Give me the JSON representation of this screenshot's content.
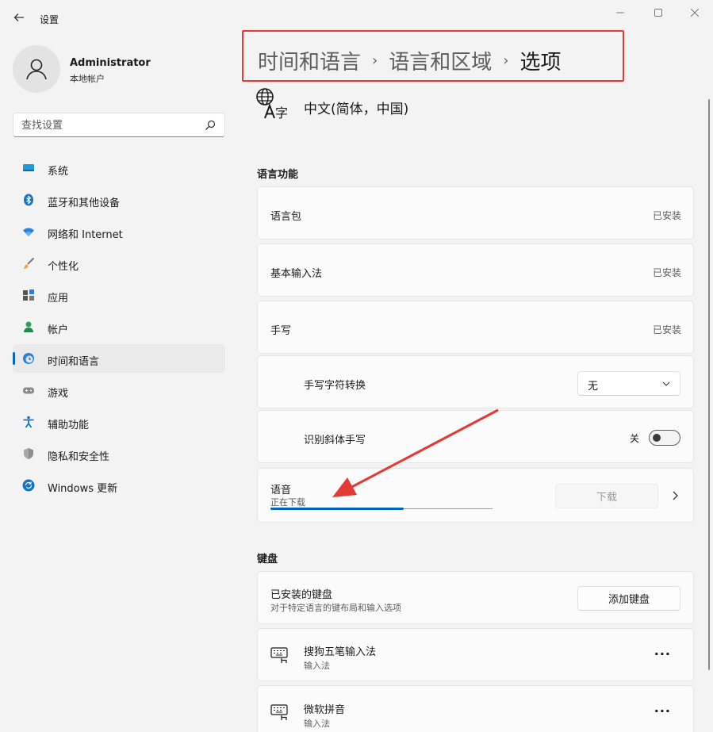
{
  "window": {
    "title": "设置"
  },
  "profile": {
    "name": "Administrator",
    "account_type": "本地帐户"
  },
  "search": {
    "placeholder": "查找设置"
  },
  "sidebar": {
    "items": [
      {
        "label": "系统",
        "icon": "system-icon",
        "active": false
      },
      {
        "label": "蓝牙和其他设备",
        "icon": "bluetooth-icon",
        "active": false
      },
      {
        "label": "网络和 Internet",
        "icon": "wifi-icon",
        "active": false
      },
      {
        "label": "个性化",
        "icon": "brush-icon",
        "active": false
      },
      {
        "label": "应用",
        "icon": "apps-icon",
        "active": false
      },
      {
        "label": "帐户",
        "icon": "account-icon",
        "active": false
      },
      {
        "label": "时间和语言",
        "icon": "time-language-icon",
        "active": true
      },
      {
        "label": "游戏",
        "icon": "gamepad-icon",
        "active": false
      },
      {
        "label": "辅助功能",
        "icon": "accessibility-icon",
        "active": false
      },
      {
        "label": "隐私和安全性",
        "icon": "shield-icon",
        "active": false
      },
      {
        "label": "Windows 更新",
        "icon": "update-icon",
        "active": false
      }
    ]
  },
  "breadcrumb": {
    "part1": "时间和语言",
    "part2": "语言和区域",
    "current": "选项"
  },
  "language": {
    "name": "中文(简体，中国)"
  },
  "language_features": {
    "title": "语言功能",
    "language_pack": {
      "label": "语言包",
      "status": "已安装"
    },
    "basic_typing": {
      "label": "基本输入法",
      "status": "已安装"
    },
    "handwriting": {
      "label": "手写",
      "status": "已安装"
    },
    "handwriting_conversion": {
      "label": "手写字符转换",
      "value": "无"
    },
    "italic_handwriting": {
      "label": "识别斜体手写",
      "toggle_state": "关"
    },
    "speech": {
      "label": "语音",
      "status": "正在下载",
      "button": "下载",
      "progress": 0.6
    }
  },
  "keyboard": {
    "title": "键盘",
    "installed": {
      "label": "已安装的键盘",
      "sub": "对于特定语言的键布局和输入选项",
      "button": "添加键盘"
    },
    "items": [
      {
        "label": "搜狗五笔输入法",
        "sub": "输入法"
      },
      {
        "label": "微软拼音",
        "sub": "输入法"
      }
    ]
  },
  "colors": {
    "accent": "#0067c0",
    "annotation": "#e53935"
  }
}
